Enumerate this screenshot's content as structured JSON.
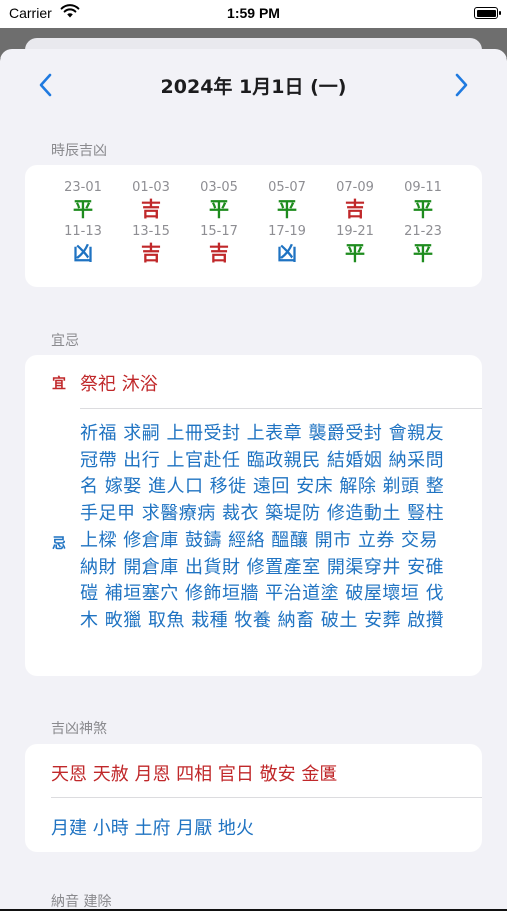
{
  "status_bar": {
    "carrier": "Carrier",
    "time": "1:59 PM"
  },
  "header": {
    "date": "2024年 1月1日 (一)",
    "prev_icon": "chevron-left-icon",
    "next_icon": "chevron-right-icon"
  },
  "shichen": {
    "title": "時辰吉凶",
    "row1": [
      {
        "range": "23-01",
        "verdict": "平",
        "color": "#1e8c1e"
      },
      {
        "range": "01-03",
        "verdict": "吉",
        "color": "#c0282a"
      },
      {
        "range": "03-05",
        "verdict": "平",
        "color": "#1e8c1e"
      },
      {
        "range": "05-07",
        "verdict": "平",
        "color": "#1e8c1e"
      },
      {
        "range": "07-09",
        "verdict": "吉",
        "color": "#c0282a"
      },
      {
        "range": "09-11",
        "verdict": "平",
        "color": "#1e8c1e"
      }
    ],
    "row2": [
      {
        "range": "11-13",
        "verdict": "凶",
        "color": "#1f73c2"
      },
      {
        "range": "13-15",
        "verdict": "吉",
        "color": "#c0282a"
      },
      {
        "range": "15-17",
        "verdict": "吉",
        "color": "#c0282a"
      },
      {
        "range": "17-19",
        "verdict": "凶",
        "color": "#1f73c2"
      },
      {
        "range": "19-21",
        "verdict": "平",
        "color": "#1e8c1e"
      },
      {
        "range": "21-23",
        "verdict": "平",
        "color": "#1e8c1e"
      }
    ]
  },
  "yiji": {
    "title": "宜忌",
    "yi_label": "宜",
    "yi_text": "祭祀 沐浴",
    "ji_label": "忌",
    "ji_text": "祈福 求嗣 上冊受封 上表章 襲爵受封 會親友 冠帶 出行 上官赴任 臨政親民 結婚姻 納采問名 嫁娶 進人口 移徙 遠回 安床 解除 剃頭 整手足甲 求醫療病 裁衣 築堤防 修造動土 豎柱上樑 修倉庫 鼓鑄 經絡 醞釀 開市 立券 交易 納財 開倉庫 出貨財 修置產室 開渠穿井 安碓磑 補垣塞穴 修飾垣牆 平治道塗 破屋壞垣 伐木 畋獵 取魚 栽種 牧養 納畜 破土 安葬 啟攢"
  },
  "shensha": {
    "title": "吉凶神煞",
    "good": "天恩 天赦 月恩 四相 官日 敬安 金匱",
    "bad": "月建 小時 土府 月厭 地火"
  },
  "next_section": {
    "title": "納音 建除"
  },
  "colors": {
    "good": "#c0282a",
    "neutral": "#1e8c1e",
    "bad": "#1f73c2",
    "accent": "#1f7ae0"
  }
}
